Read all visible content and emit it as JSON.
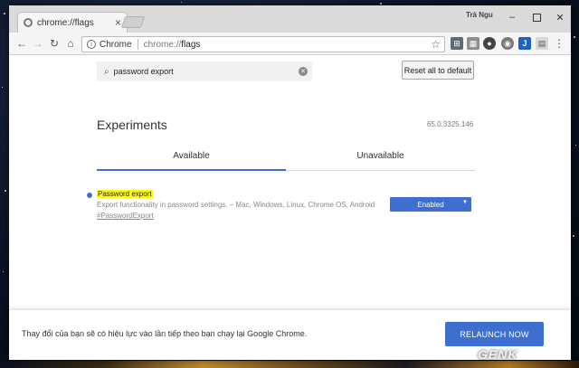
{
  "colors": {
    "accent": "#3e6fd0",
    "highlight": "#ffff00",
    "desktop": "#0a1222"
  },
  "tab": {
    "title": "chrome://flags",
    "favicon": "chrome-flags-icon",
    "close": "×"
  },
  "window": {
    "user_name": "Trả Ngu",
    "minimize": "–",
    "close": "✕"
  },
  "toolbar": {
    "back": "←",
    "forward": "→",
    "reload": "↻",
    "home": "⌂",
    "origin_label": "Chrome",
    "url_scheme": "chrome://",
    "url_host": "flags",
    "bookmark": "☆",
    "extensions": [
      "⊞",
      "▦",
      "●",
      "◉",
      "J",
      "▤"
    ],
    "menu": "⋮"
  },
  "search": {
    "icon": "🔍",
    "value": "password export",
    "clear": "✕"
  },
  "reset_button": "Reset all to default",
  "page_title": "Experiments",
  "version": "65.0.3325.146",
  "tabs": {
    "available": "Available",
    "unavailable": "Unavailable"
  },
  "flag": {
    "name": "Password export",
    "description": "Export functionality in password settings. – Mac, Windows, Linux, Chrome OS, Android",
    "link": "#PasswordExport",
    "selected": "Enabled",
    "caret": "▼"
  },
  "footer": {
    "message": "Thay đổi của bạn sẽ có hiệu lực vào lần tiếp theo bạn chạy lại Google Chrome.",
    "relaunch": "RELAUNCH NOW"
  },
  "watermark": "GENK"
}
